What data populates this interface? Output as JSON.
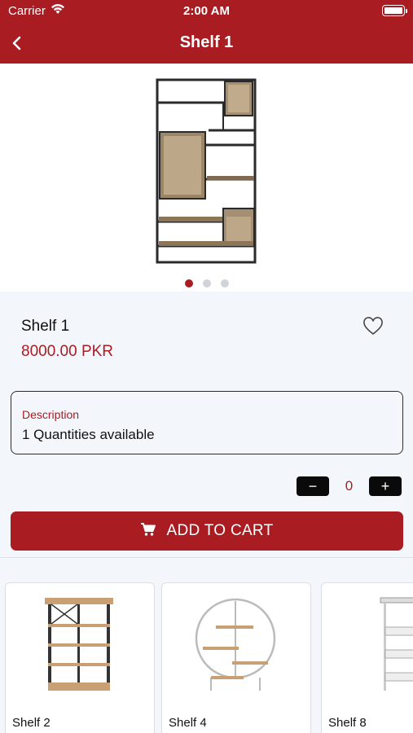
{
  "status_bar": {
    "carrier": "Carrier",
    "time": "2:00 AM"
  },
  "nav": {
    "title": "Shelf 1",
    "back_icon": "chevron-left-icon"
  },
  "carousel": {
    "page_count": 3,
    "active_index": 0
  },
  "product": {
    "name": "Shelf 1",
    "price": "8000.00 PKR",
    "favorite_icon": "heart-outline-icon",
    "description_label": "Description",
    "description_value": "1 Quantities available"
  },
  "quantity": {
    "minus": "−",
    "value": "0",
    "plus": "+"
  },
  "cart": {
    "label": "ADD TO CART",
    "icon": "cart-icon"
  },
  "related": [
    {
      "name": "Shelf 2"
    },
    {
      "name": "Shelf 4"
    },
    {
      "name": "Shelf 8"
    }
  ],
  "colors": {
    "accent": "#a81c22",
    "background": "#f3f7fb",
    "button_dark": "#0a0a0a"
  }
}
